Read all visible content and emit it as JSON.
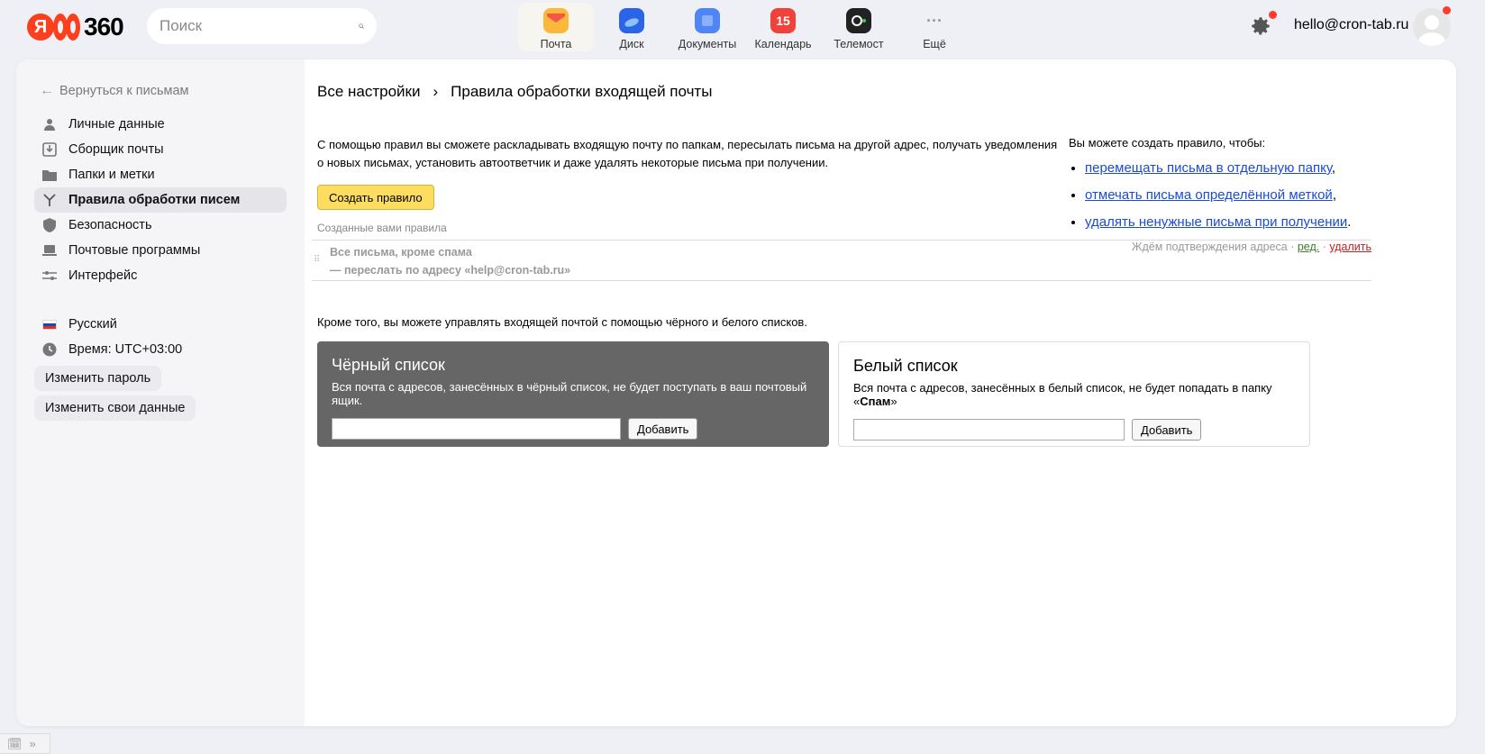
{
  "header": {
    "logo_text": "360",
    "search_placeholder": "Поиск",
    "apps": [
      {
        "label": "Почта",
        "icon": "mail-icon",
        "color": "#fbb83a"
      },
      {
        "label": "Диск",
        "icon": "disk-icon",
        "color": "#2a65e8"
      },
      {
        "label": "Документы",
        "icon": "documents-icon",
        "color": "#4f86f7"
      },
      {
        "label": "Календарь",
        "icon": "calendar-icon",
        "color": "#f0423a",
        "badge": "15"
      },
      {
        "label": "Телемост",
        "icon": "telemost-icon",
        "color": "#222222"
      },
      {
        "label": "Ещё",
        "icon": "more-icon",
        "color": "#999999"
      }
    ],
    "user_email": "hello@cron-tab.ru"
  },
  "sidebar": {
    "back_label": "Вернуться к письмам",
    "items": [
      {
        "label": "Личные данные",
        "icon": "person-icon"
      },
      {
        "label": "Сборщик почты",
        "icon": "collector-icon"
      },
      {
        "label": "Папки и метки",
        "icon": "folder-icon"
      },
      {
        "label": "Правила обработки писем",
        "icon": "rules-icon",
        "active": true
      },
      {
        "label": "Безопасность",
        "icon": "shield-icon"
      },
      {
        "label": "Почтовые программы",
        "icon": "laptop-icon"
      },
      {
        "label": "Интерфейс",
        "icon": "sliders-icon"
      }
    ],
    "language": "Русский",
    "time": "Время: UTC+03:00",
    "change_password": "Изменить пароль",
    "change_data": "Изменить свои данные"
  },
  "content": {
    "breadcrumb_root": "Все настройки",
    "breadcrumb_current": "Правила обработки входящей почты",
    "intro": "С помощью правил вы сможете раскладывать входящую почту по папкам, пересылать письма на другой адрес, получать уведомления о новых письмах, установить автоответчик и даже удалять некоторые письма при получении.",
    "create_button": "Создать правило",
    "rules_title": "Созданные вами правила",
    "rule": {
      "condition": "Все письма, кроме спама",
      "action": "— переслать по адресу «help@cron-tab.ru»",
      "status": "Ждём подтверждения адреса",
      "edit": "ред.",
      "delete": "удалить"
    },
    "right_intro": "Вы можете создать правило, чтобы:",
    "right_links": [
      "перемещать письма в отдельную папку",
      "отмечать письма определённой меткой",
      "удалять ненужные письма при получении"
    ],
    "right_endings": [
      ",",
      ",",
      "."
    ],
    "lists_intro": "Кроме того, вы можете управлять входящей почтой с помощью чёрного и белого списков.",
    "blacklist": {
      "title": "Чёрный список",
      "desc": "Вся почта с адресов, занесённых в чёрный список, не будет поступать в ваш почтовый ящик.",
      "add": "Добавить"
    },
    "whitelist": {
      "title": "Белый список",
      "desc_prefix": "Вся почта с адресов, занесённых в белый список, не будет попадать в папку «",
      "desc_bold": "Спам",
      "desc_suffix": "»",
      "add": "Добавить"
    }
  }
}
